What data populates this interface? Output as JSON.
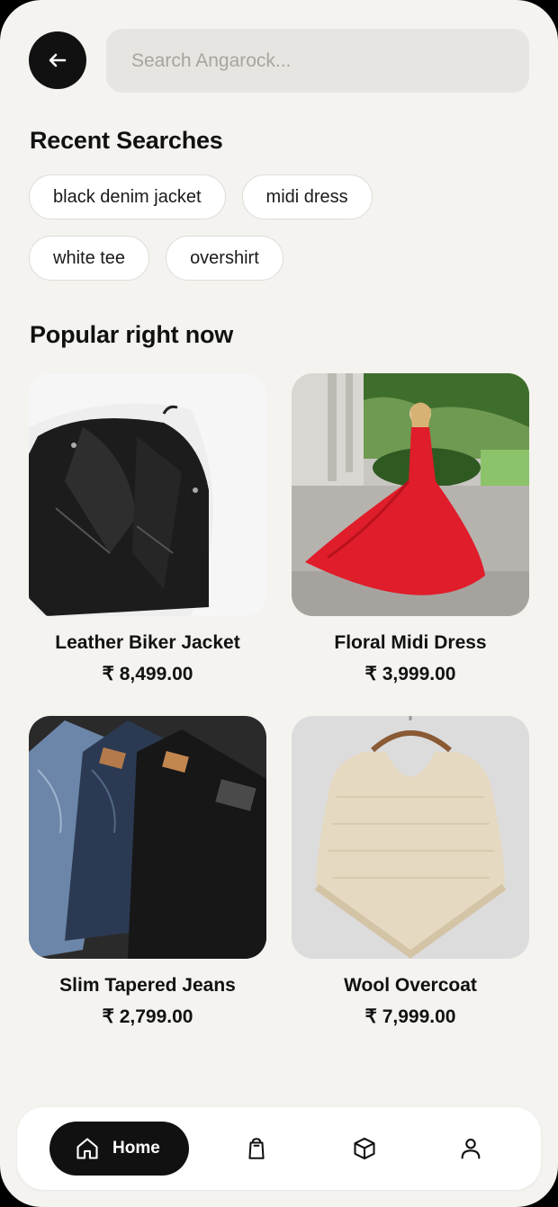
{
  "search": {
    "placeholder": "Search Angarock..."
  },
  "icons": {
    "back": "arrow-left-icon",
    "home": "home-icon",
    "bag": "shopping-bag-icon",
    "box": "box-icon",
    "user": "user-icon"
  },
  "recent": {
    "title": "Recent Searches",
    "chips": [
      "black denim jacket",
      "midi dress",
      "white tee",
      "overshirt"
    ]
  },
  "popular": {
    "title": "Popular right now",
    "products": [
      {
        "name": "Leather Biker Jacket",
        "price": "₹ 8,499.00"
      },
      {
        "name": "Floral Midi Dress",
        "price": "₹ 3,999.00"
      },
      {
        "name": "Slim Tapered Jeans",
        "price": "₹ 2,799.00"
      },
      {
        "name": "Wool Overcoat",
        "price": "₹ 7,999.00"
      }
    ]
  },
  "nav": {
    "home_label": "Home",
    "active": "home"
  },
  "colors": {
    "background": "#f4f3f0",
    "accent": "#111111",
    "search_bg": "#e7e5e1"
  }
}
